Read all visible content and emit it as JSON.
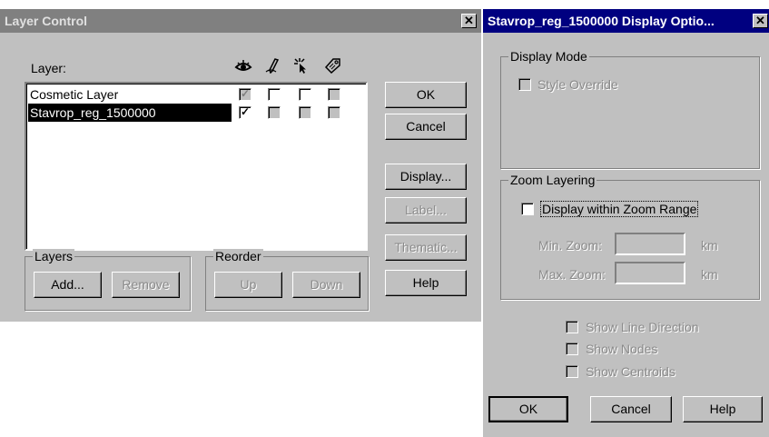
{
  "layer_control": {
    "title": "Layer Control",
    "layer_label": "Layer:",
    "column_icons": [
      "visible-eye-icon",
      "editable-pencil-icon",
      "selectable-cursor-icon",
      "autolabel-tag-icon"
    ],
    "layers": [
      {
        "name": "Cosmetic Layer",
        "visible": true,
        "editable": false,
        "selectable": false,
        "autolabel": false,
        "selected": false,
        "visible_disabled": true
      },
      {
        "name": "Stavrop_reg_1500000",
        "visible": true,
        "editable": false,
        "selectable": false,
        "autolabel": false,
        "selected": true,
        "visible_disabled": false
      }
    ],
    "buttons": {
      "ok": "OK",
      "cancel": "Cancel",
      "display": "Display...",
      "label": "Label...",
      "thematic": "Thematic...",
      "help": "Help"
    },
    "layers_group": {
      "title": "Layers",
      "add": "Add...",
      "remove": "Remove"
    },
    "reorder_group": {
      "title": "Reorder",
      "up": "Up",
      "down": "Down"
    }
  },
  "display_options": {
    "title": "Stavrop_reg_1500000 Display Optio...",
    "display_mode": {
      "title": "Display Mode",
      "style_override": "Style Override",
      "style_override_checked": false
    },
    "zoom_layering": {
      "title": "Zoom Layering",
      "display_within_zoom": "Display within Zoom Range",
      "display_within_zoom_checked": false,
      "min_zoom_label": "Min. Zoom:",
      "min_zoom_value": "",
      "max_zoom_label": "Max. Zoom:",
      "max_zoom_value": "",
      "unit": "km"
    },
    "options": [
      {
        "label": "Show Line Direction",
        "checked": false
      },
      {
        "label": "Show Nodes",
        "checked": false
      },
      {
        "label": "Show Centroids",
        "checked": false
      }
    ],
    "buttons": {
      "ok": "OK",
      "cancel": "Cancel",
      "help": "Help"
    }
  }
}
